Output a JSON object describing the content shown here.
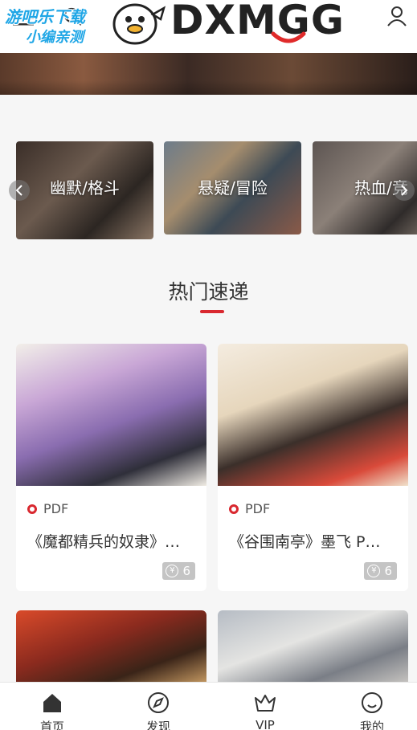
{
  "watermark": {
    "line1": "游吧乐下载",
    "line2": "小编亲测"
  },
  "header": {
    "logo_text": "DXMGG"
  },
  "categories": [
    {
      "label": "幽默/格斗"
    },
    {
      "label": "悬疑/冒险"
    },
    {
      "label": "热血/竞"
    }
  ],
  "section": {
    "title": "热门速递"
  },
  "products": [
    {
      "type": "PDF",
      "title": "《魔都精兵的奴隶》…",
      "price": "6"
    },
    {
      "type": "PDF",
      "title": "《谷围南亭》墨飞 P…",
      "price": "6"
    }
  ],
  "nav": {
    "items": [
      {
        "label": "首页"
      },
      {
        "label": "发现"
      },
      {
        "label": "VIP"
      },
      {
        "label": "我的"
      }
    ]
  },
  "colors": {
    "accent": "#d9282f",
    "price_badge": "#c4c4c4",
    "watermark": "#1fa6e6"
  }
}
